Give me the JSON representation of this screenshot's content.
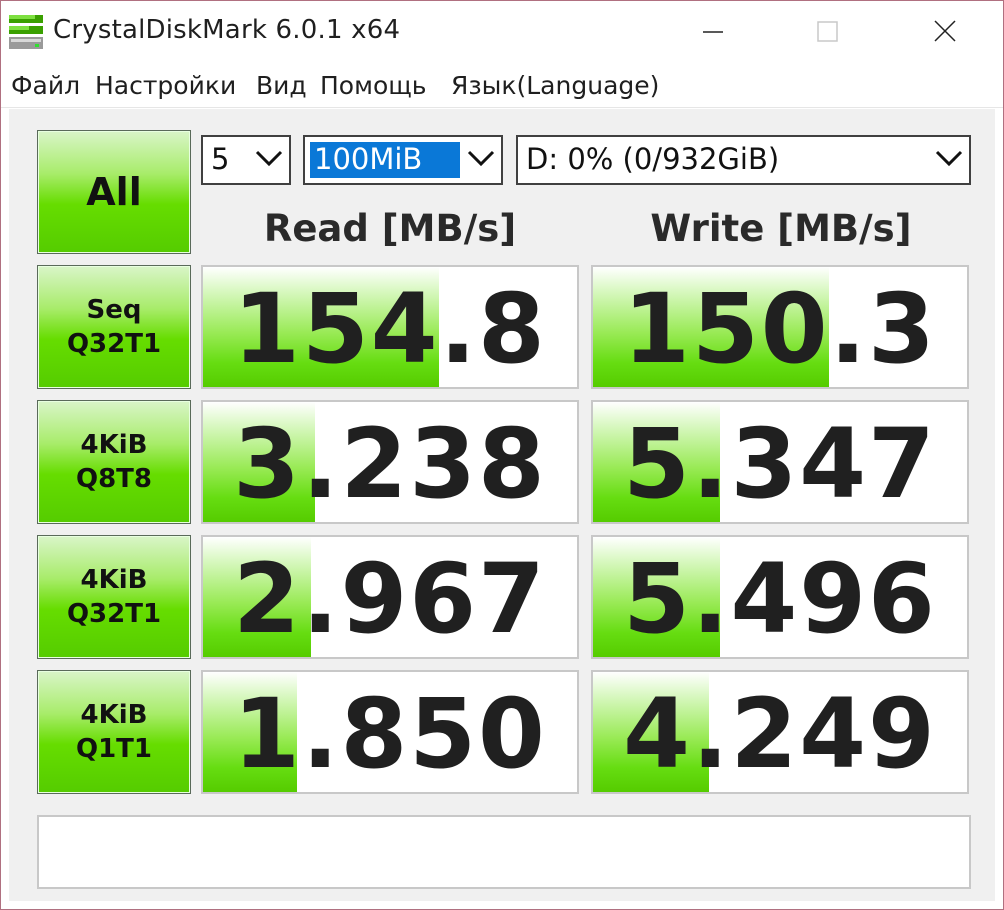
{
  "window": {
    "title": "CrystalDiskMark 6.0.1 x64",
    "icon": "crystaldiskmark-app-icon"
  },
  "menu": [
    {
      "label": "Файл"
    },
    {
      "label": "Настройки"
    },
    {
      "label": "Вид"
    },
    {
      "label": "Помощь"
    },
    {
      "label": "Язык(Language)"
    }
  ],
  "controls": {
    "all_label": "All",
    "count": "5",
    "size": "100MiB",
    "drive": "D: 0% (0/932GiB)"
  },
  "headers": {
    "read": "Read [MB/s]",
    "write": "Write [MB/s]"
  },
  "tests": [
    {
      "line1": "Seq",
      "line2": "Q32T1",
      "read": "154.8",
      "write": "150.3",
      "read_fill": 0.63,
      "write_fill": 0.63
    },
    {
      "line1": "4KiB",
      "line2": "Q8T8",
      "read": "3.238",
      "write": "5.347",
      "read_fill": 0.3,
      "write_fill": 0.34
    },
    {
      "line1": "4KiB",
      "line2": "Q32T1",
      "read": "2.967",
      "write": "5.496",
      "read_fill": 0.29,
      "write_fill": 0.34
    },
    {
      "line1": "4KiB",
      "line2": "Q1T1",
      "read": "1.850",
      "write": "4.249",
      "read_fill": 0.25,
      "write_fill": 0.31
    }
  ],
  "comment": "",
  "colors": {
    "button_green": "#55cc00",
    "selection_blue": "#0a78d7",
    "cell_border": "#c8c8c8",
    "window_border": "#b07080"
  }
}
